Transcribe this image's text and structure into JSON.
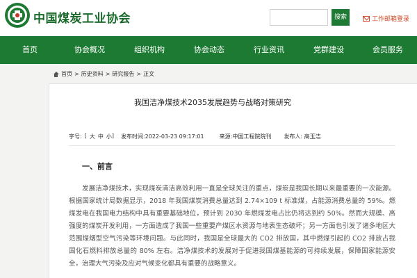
{
  "header": {
    "site_name": "中国煤炭工业协会",
    "search_placeholder": "",
    "search_button": "搜索",
    "email_link": "工作邮箱登录",
    "logo_icon": "coal-association-emblem-icon",
    "accent_color": "#1d7a33"
  },
  "nav": {
    "items": [
      {
        "label": "首页"
      },
      {
        "label": "协会概况"
      },
      {
        "label": "组织机构"
      },
      {
        "label": "协会动态"
      },
      {
        "label": "行业资讯"
      },
      {
        "label": "党群建设"
      },
      {
        "label": "会员服务"
      }
    ]
  },
  "breadcrumb": {
    "items": [
      "首页",
      "历史资料",
      "研究报告",
      "正文"
    ],
    "separator": ">"
  },
  "article": {
    "title": "我国洁净煤技术2035发展趋势与战略对策研究",
    "meta": {
      "font_size_label": "字号:",
      "font_size_open": "[",
      "font_large": "大",
      "font_medium": "中",
      "font_small": "小",
      "font_size_close": "]",
      "publish_time": "发布时间:2022-03-23 09:17:01",
      "source": "来源:中国工程院院刊",
      "author": "发布人: 高玉洁"
    },
    "section_heading": "一、前言",
    "paragraph": "发展洁净煤技术，实现煤炭清洁高效利用一直是全球关注的重点，煤炭是我国长期以来最重要的一次能源。根据国家统计局数据显示，2018 年我国煤炭消费总量达到 2.74×109 t 标准煤，占能源消费总量的 59%。燃煤发电在我国电力结构中具有重要基础地位，预计到 2030 年燃煤发电占比仍将达到约 50%。然而大规模、高强度的煤炭开发利用，一方面造成了我国一些重要产煤区水资源与地表生态破坏；另一方面也引发了诸多地区大范围煤烟型空气污染等环境问题。与此同时，我国是全球最大的 CO2 排放国，其中燃煤引起的 CO2 排放占我国化石燃料排放总量的 80% 左右。洁净煤技术的发展对于促进我国煤基能源的可持续发展，保障国家能源安全，治理大气污染及应对气候变化都具有重要的战略意义。"
  }
}
